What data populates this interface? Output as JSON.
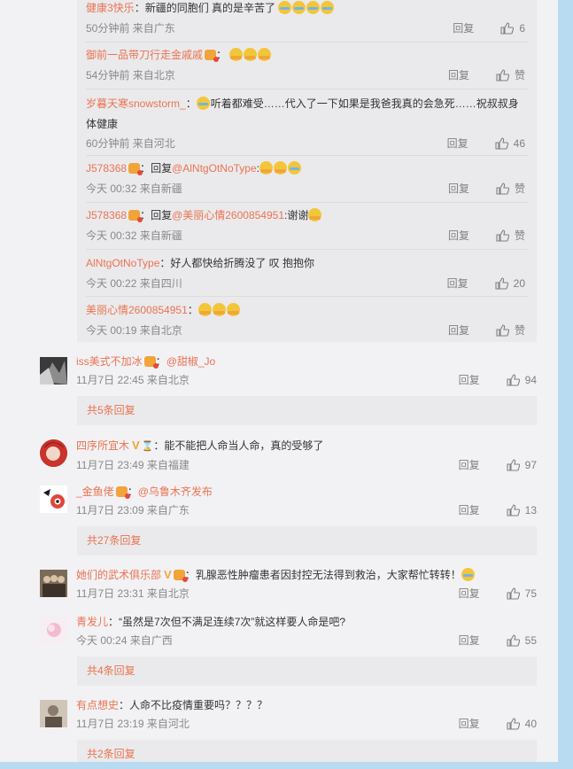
{
  "replies": [
    {
      "user": "健康3快乐",
      "sep": "：",
      "text": "新疆的同胞们 真的是辛苦了",
      "emojis": 4,
      "emoji_type": "cry",
      "time": "50分钟前",
      "source": "来自广东",
      "reply": "回复",
      "likes": "6"
    },
    {
      "user": "御前一品带刀行走金戚戚",
      "sep": "：",
      "text": "",
      "badge": true,
      "emojis": 3,
      "emoji_type": "hug",
      "time": "54分钟前",
      "source": "来自北京",
      "reply": "回复",
      "likes": "赞"
    },
    {
      "user": "岁暮天寒snowstorm_",
      "sep": "：",
      "text": "听着都难受……代入了一下如果是我爸我真的会急死……祝叔叔身体健康",
      "lead_emoji": "cry",
      "time": "60分钟前",
      "source": "来自河北",
      "reply": "回复",
      "likes": "46"
    },
    {
      "user": "J578368",
      "badge": true,
      "sep": "：",
      "text": "回复",
      "mention": "@AlNtgOtNoType",
      "after": ":",
      "emojis": 3,
      "emoji_type": "hug",
      "time": "今天 00:32",
      "source": "来自新疆",
      "reply": "回复",
      "likes": "赞"
    },
    {
      "user": "J578368",
      "badge": true,
      "sep": "：",
      "text": "回复",
      "mention": "@美丽心情2600854951",
      "after": ":谢谢",
      "emojis": 1,
      "emoji_type": "hug",
      "time": "今天 00:32",
      "source": "来自新疆",
      "reply": "回复",
      "likes": "赞"
    },
    {
      "user": "AlNtgOtNoType",
      "sep": "：",
      "text": "好人都快给折腾没了 叹 抱抱你",
      "time": "今天 00:22",
      "source": "来自四川",
      "reply": "回复",
      "likes": "20"
    },
    {
      "user": "美丽心情2600854951",
      "sep": "：",
      "text": "",
      "emojis": 3,
      "emoji_type": "hug",
      "time": "今天 00:19",
      "source": "来自北京",
      "reply": "回复",
      "likes": "赞"
    }
  ],
  "comments": [
    {
      "user": "iss美式不加冰",
      "badge": true,
      "sep": "：",
      "mention": "@甜椒_Jo",
      "text": "",
      "time": "11月7日 22:45",
      "source": "来自北京",
      "reply": "回复",
      "likes": "94",
      "expand": "共5条回复"
    },
    {
      "user": "四序所宜木",
      "vip": "V",
      "hourglass": "⌛",
      "sep": "：",
      "text": "能不能把人命当人命，真的受够了",
      "time": "11月7日 23:49",
      "source": "来自福建",
      "reply": "回复",
      "likes": "97"
    },
    {
      "user": "_金鱼佬",
      "badge": true,
      "sep": "：",
      "mention": "@乌鲁木齐发布",
      "text": "",
      "time": "11月7日 23:09",
      "source": "来自广东",
      "reply": "回复",
      "likes": "13",
      "expand": "共27条回复"
    },
    {
      "user": "她们的武术俱乐部",
      "vip": "V",
      "badge": true,
      "sep": "：",
      "text": "乳腺恶性肿瘤患者因封控无法得到救治，大家帮忙转转！",
      "trail_emoji": "cry",
      "time": "11月7日 23:31",
      "source": "来自北京",
      "reply": "回复",
      "likes": "75"
    },
    {
      "user": "青发儿",
      "sep": "：",
      "text": "“虽然是7次但不满足连续7次”就这样要人命是吧?",
      "time": "今天 00:24",
      "source": "来自广西",
      "reply": "回复",
      "likes": "55",
      "expand": "共4条回复"
    },
    {
      "user": "有点想史",
      "sep": "：",
      "text": "人命不比疫情重要吗？？？？",
      "time": "11月7日 23:19",
      "source": "来自河北",
      "reply": "回复",
      "likes": "40",
      "expand": "共2条回复"
    }
  ],
  "colors": {
    "name": "#eb7350",
    "page_bg": "#b9dbf1",
    "card_bg": "#f2f2f5",
    "reply_bg": "#eaeaec"
  }
}
